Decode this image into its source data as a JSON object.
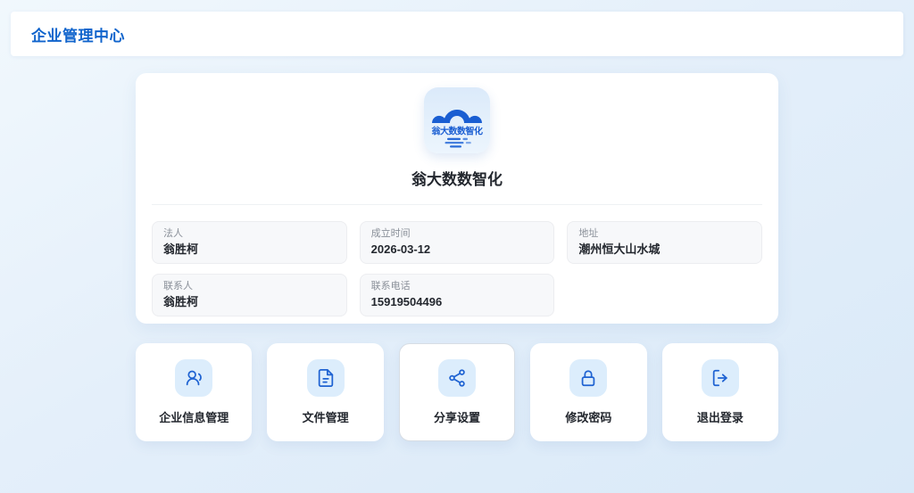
{
  "colors": {
    "accent_blue": "#1064cc",
    "icon_blue": "#1f63d2",
    "chip_background": "#dcedfc",
    "page_background_top": "#f1f8fd",
    "page_background_bottom": "#d9e9f8",
    "card_background": "#ffffff",
    "field_background": "#f7f8fa"
  },
  "header": {
    "title": "企业管理中心"
  },
  "company": {
    "name": "翁大数数智化",
    "logo_text": "翁大数数智化",
    "logo_icon": "cloud-bridge-logo-icon"
  },
  "profile": {
    "fields": [
      {
        "label": "法人",
        "value": "翁胜柯"
      },
      {
        "label": "成立时间",
        "value": "2026-03-12"
      },
      {
        "label": "地址",
        "value": "潮州恒大山水城"
      },
      {
        "label": "联系人",
        "value": "翁胜柯"
      },
      {
        "label": "联系电话",
        "value": "15919504496"
      }
    ]
  },
  "actions": {
    "items": [
      {
        "label": "企业信息管理",
        "icon": "users-icon"
      },
      {
        "label": "文件管理",
        "icon": "file-document-icon"
      },
      {
        "label": "分享设置",
        "icon": "share-icon"
      },
      {
        "label": "修改密码",
        "icon": "lock-icon"
      },
      {
        "label": "退出登录",
        "icon": "logout-icon"
      }
    ]
  }
}
